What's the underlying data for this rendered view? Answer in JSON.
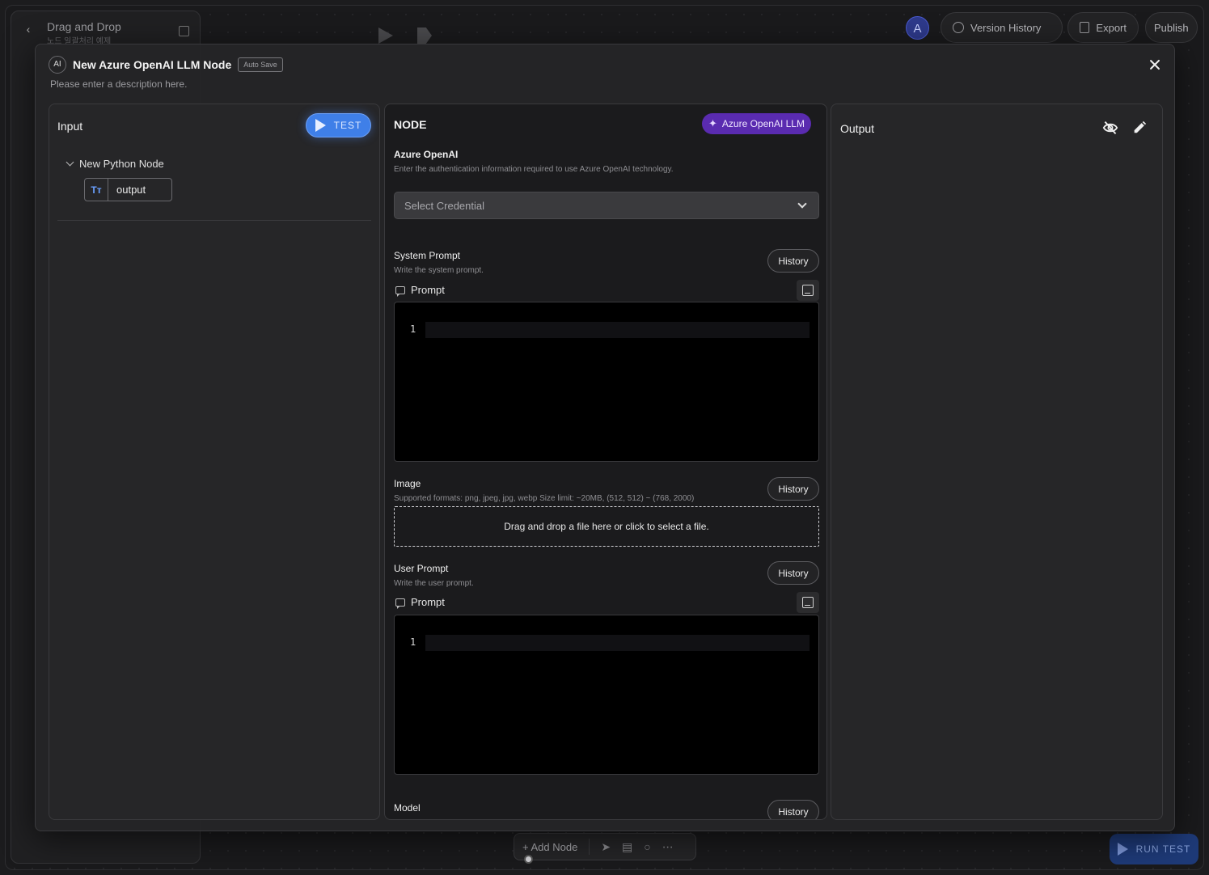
{
  "background": {
    "workflow_title": "Drag and Drop",
    "workflow_subtitle": "노드 일괄처리 예제",
    "avatar_letter": "A",
    "version_history_label": "Version History",
    "export_label": "Export",
    "publish_label": "Publish",
    "add_node_label": "+ Add Node",
    "run_test_label": "RUN TEST"
  },
  "modal": {
    "ai_badge": "AI",
    "title": "New Azure OpenAI LLM Node",
    "auto_save_label": "Auto Save",
    "description_placeholder": "Please enter a description here."
  },
  "input_panel": {
    "title": "Input",
    "test_button_label": "TEST",
    "tree": {
      "node_name": "New Python Node",
      "fields": [
        {
          "type_icon": "Tт",
          "name": "output"
        }
      ]
    }
  },
  "node_panel": {
    "title": "NODE",
    "type_badge": "Azure OpenAI LLM",
    "credential": {
      "label": "Azure OpenAI",
      "hint": "Enter the authentication information required to use Azure OpenAI technology.",
      "select_placeholder": "Select Credential"
    },
    "system_prompt": {
      "label": "System Prompt",
      "hint": "Write the system prompt.",
      "history_label": "History",
      "prompt_label": "Prompt",
      "line_number": "1"
    },
    "image": {
      "label": "Image",
      "hint": "Supported formats: png, jpeg, jpg, webp Size limit: ~20MB, (512, 512) ~ (768, 2000)",
      "history_label": "History",
      "dropzone_text": "Drag and drop a file here or click to select a file."
    },
    "user_prompt": {
      "label": "User Prompt",
      "hint": "Write the user prompt.",
      "history_label": "History",
      "prompt_label": "Prompt",
      "line_number": "1"
    },
    "model": {
      "label": "Model",
      "history_label": "History"
    }
  },
  "output_panel": {
    "title": "Output"
  },
  "colors": {
    "accent_blue": "#3f7fe8",
    "badge_purple": "#5a2bb0",
    "panel_bg": "#262628",
    "editor_bg": "#000000"
  }
}
